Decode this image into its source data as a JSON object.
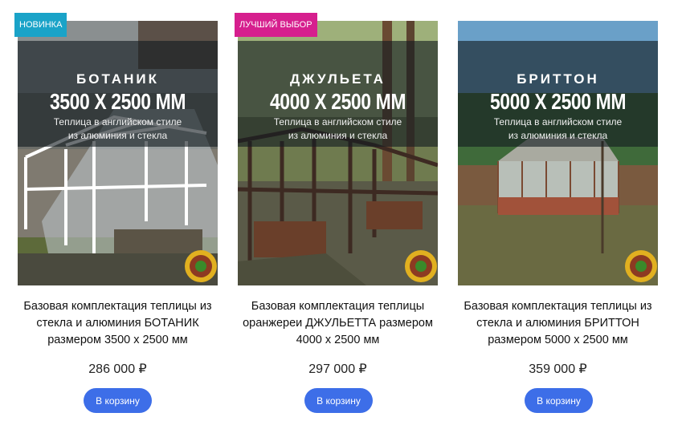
{
  "products": [
    {
      "badge": "НОВИНКА",
      "badge_color": "#1aa3c8",
      "overlay_name": "БОТАНИК",
      "overlay_size": "3500 X 2500 ММ",
      "overlay_sub_1": "Теплица в английском стиле",
      "overlay_sub_2": "из алюминия и стекла",
      "title_1": "Базовая комплектация теплицы из",
      "title_2": "стекла и алюминия БОТАНИК",
      "title_3": "размером 3500 х 2500 мм",
      "price": "286 000 ₽",
      "button": "В корзину"
    },
    {
      "badge": "ЛУЧШИЙ ВЫБОР",
      "badge_color": "#d61f8e",
      "overlay_name": "ДЖУЛЬЕТА",
      "overlay_size": "4000 X 2500 ММ",
      "overlay_sub_1": "Теплица в английском стиле",
      "overlay_sub_2": "из алюминия и стекла",
      "title_1": "Базовая комплектация теплицы",
      "title_2": "оранжереи ДЖУЛЬЕТТА размером",
      "title_3": "4000 х 2500 мм",
      "price": "297 000 ₽",
      "button": "В корзину"
    },
    {
      "overlay_name": "БРИТТОН",
      "overlay_size": "5000 X 2500 ММ",
      "overlay_sub_1": "Теплица в английском стиле",
      "overlay_sub_2": "из алюминия и стекла",
      "title_1": "Базовая комплектация теплицы из",
      "title_2": "стекла и алюминия БРИТТОН",
      "title_3": "размером 5000 х 2500 мм",
      "price": "359 000 ₽",
      "button": "В корзину"
    }
  ],
  "colors": {
    "button_bg": "#3d6ee8",
    "overlay_bg": "rgba(20,28,32,0.62)"
  }
}
